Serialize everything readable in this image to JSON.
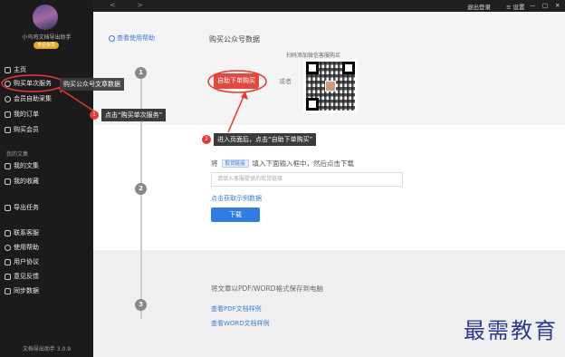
{
  "sidebar": {
    "app_title": "小鸟鸡文档导出助手",
    "vip_badge": "专业会员",
    "items": [
      {
        "label": "主页",
        "icon": "home-icon"
      },
      {
        "label": "购买单次服务",
        "icon": "clock-icon"
      },
      {
        "label": "会员自助采集",
        "icon": "user-icon"
      },
      {
        "label": "我的订单",
        "icon": "order-icon"
      },
      {
        "label": "购买会员",
        "icon": "vip-icon"
      }
    ],
    "section_label": "我的文集",
    "items2": [
      {
        "label": "我的文集",
        "icon": "doc-icon"
      },
      {
        "label": "我的收藏",
        "icon": "star-icon"
      },
      {
        "label": "导出任务",
        "icon": "export-icon"
      }
    ],
    "items3": [
      {
        "label": "联系客服",
        "icon": "chat-icon"
      },
      {
        "label": "使用帮助",
        "icon": "help-icon"
      },
      {
        "label": "用户协议",
        "icon": "agreement-icon"
      },
      {
        "label": "意见反馈",
        "icon": "feedback-icon"
      },
      {
        "label": "同步数据",
        "icon": "sync-icon"
      }
    ],
    "version": "文档导出助手 3.0.9"
  },
  "topbar": {
    "back": "<",
    "forward": ">",
    "logout": "退出登录",
    "settings": "设置",
    "minimize": "—",
    "maximize": "□",
    "close": "✕"
  },
  "main": {
    "help_link": "查看使用帮助",
    "step1": {
      "num": "1",
      "title": "购买公众号数据",
      "buy_button": "自助下单购买",
      "or_text": "或者",
      "qr_caption": "扫码添加微信客服购买"
    },
    "step2": {
      "num": "2",
      "prefix": "将",
      "tag": "取货链接",
      "suffix": "填入下面输入框中，然后点击下载",
      "input_placeholder": "请填入客服提供的取货链接",
      "example_link": "点击获取示例数据",
      "download_button": "下载"
    },
    "step3": {
      "num": "3",
      "text": "将文章以PDF/WORD格式保存到电脑",
      "pdf_link": "查看PDF文档样例",
      "word_link": "查看WORD文档样例"
    }
  },
  "annotations": {
    "tooltip": "购买公众号文章数据",
    "step1_badge": "1",
    "step1_text": "点击“购买单次服务”",
    "step2_badge": "2",
    "step2_text": "进入页面后，点击“自助下单购买”"
  },
  "watermark": "最需教育",
  "colors": {
    "accent_red": "#e04a3f",
    "link_blue": "#3b7bd4",
    "sidebar_bg": "#1b1b1b"
  }
}
